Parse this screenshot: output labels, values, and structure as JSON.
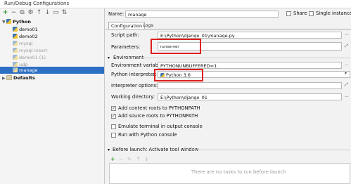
{
  "window": {
    "title": "Run/Debug Configurations"
  },
  "toolbar": {
    "add": "+",
    "remove": "−",
    "copy": "⧉",
    "settings": "⚙",
    "up": "↑",
    "down": "↓",
    "folder": "▭",
    "sort": "⇅"
  },
  "tree": {
    "python_label": "Python",
    "items": [
      "demo01",
      "demo02",
      "mysql",
      "mysql-insert",
      "demo01 (1)",
      "udp",
      "manage"
    ],
    "defaults_label": "Defaults"
  },
  "name_field": {
    "label": "Name:",
    "value": "manage",
    "share_label": "Share",
    "single_instance_label": "Single instance onl"
  },
  "tabs": [
    "Configuration",
    "Logs"
  ],
  "config": {
    "script_path_label": "Script path:",
    "script_path_value": "E:\\Python\\django_01\\manage.py",
    "parameters_label": "Parameters:",
    "parameters_value": "runserver",
    "environment_header": "Environment",
    "env_vars_label": "Environment variables:",
    "env_vars_value": "PYTHONUNBUFFERED=1",
    "interpreter_label": "Python interpreter:",
    "interpreter_value": "Python 3.6",
    "interp_options_label": "Interpreter options:",
    "working_dir_label": "Working directory:",
    "working_dir_value": "E:\\Python\\django_01",
    "check_content_roots": "Add content roots to PYTHONPATH",
    "check_source_roots": "Add source roots to PYTHONPATH",
    "check_emulate": "Emulate terminal in output console",
    "check_python_console": "Run with Python console"
  },
  "before_launch": {
    "header": "Before launch: Activate tool window",
    "empty_text": "There are no tasks to run before launch"
  },
  "buttons": {
    "browse": "...",
    "expand": "⤢",
    "dropdown": "▾"
  },
  "colors": {
    "accent": "#2d6fc2",
    "highlight_box": "#e01d1d",
    "python_blue": "#3b77b0",
    "python_yellow": "#f3c333"
  }
}
